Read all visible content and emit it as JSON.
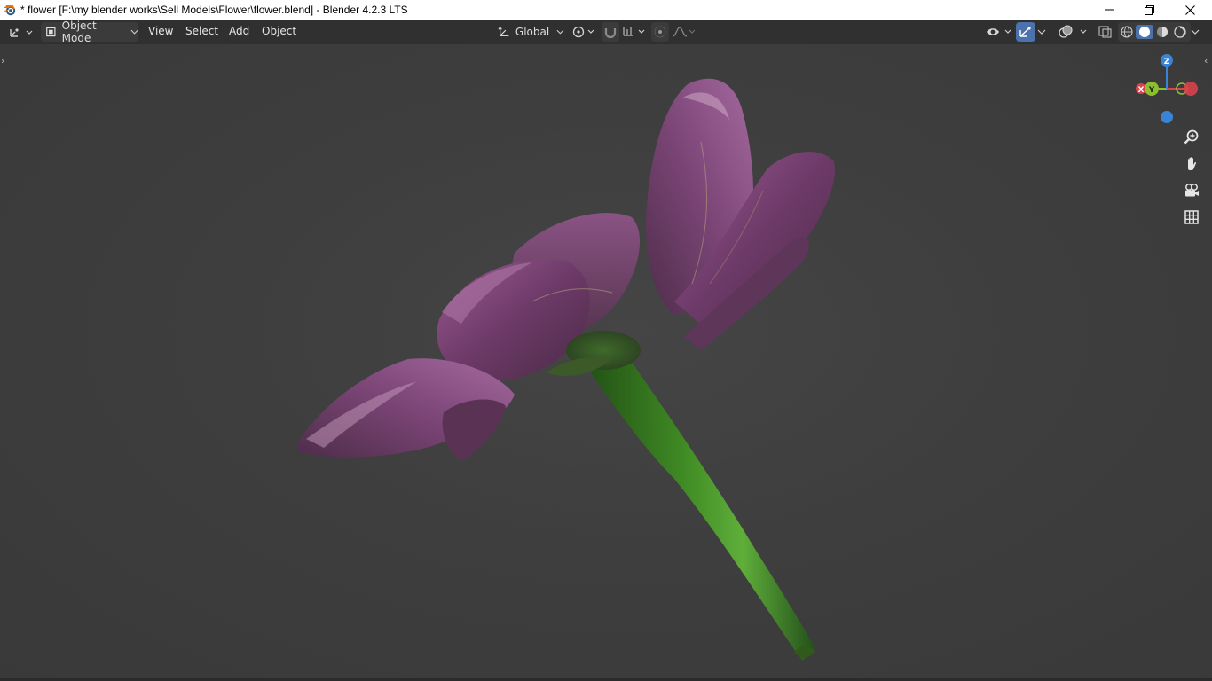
{
  "window": {
    "title": "* flower [F:\\my blender works\\Sell Models\\Flower\\flower.blend] - Blender 4.2.3 LTS",
    "app_icon": "blender-logo-icon",
    "controls": [
      "minimize-icon",
      "restore-icon",
      "close-icon"
    ]
  },
  "header": {
    "editor_type_icon": "3d-viewport-icon",
    "mode": "Object Mode",
    "menus": [
      "View",
      "Select",
      "Add",
      "Object"
    ],
    "transform_orientation": "Global",
    "pivot_icon": "pivot-point-icon",
    "snap_icon": "snap-magnet-icon",
    "snap_target_icon": "snap-increment-icon",
    "proportional_icon": "proportional-editing-icon",
    "falloff_icon": "falloff-curve-icon",
    "visibility_icon": "object-visibility-icon",
    "gizmo_icon": "viewport-gizmos-icon",
    "overlay_icon": "overlays-icon",
    "xray_icon": "xray-toggle-icon",
    "shading_modes": [
      "wireframe",
      "solid",
      "material-preview",
      "rendered"
    ],
    "active_shading": "solid",
    "colors": {
      "header_bg": "#303030",
      "viewport_bg": "#3d3d3d",
      "accent": "#4b72ad",
      "axis_x": "#d8434d",
      "axis_y": "#8ac02f",
      "axis_z": "#3a84d6"
    }
  },
  "viewport": {
    "gizmo": {
      "z": "Z",
      "y": "Y",
      "x": "X"
    },
    "nav_buttons": [
      "zoom-icon",
      "pan-hand-icon",
      "camera-view-icon",
      "orthographic-grid-icon"
    ]
  }
}
